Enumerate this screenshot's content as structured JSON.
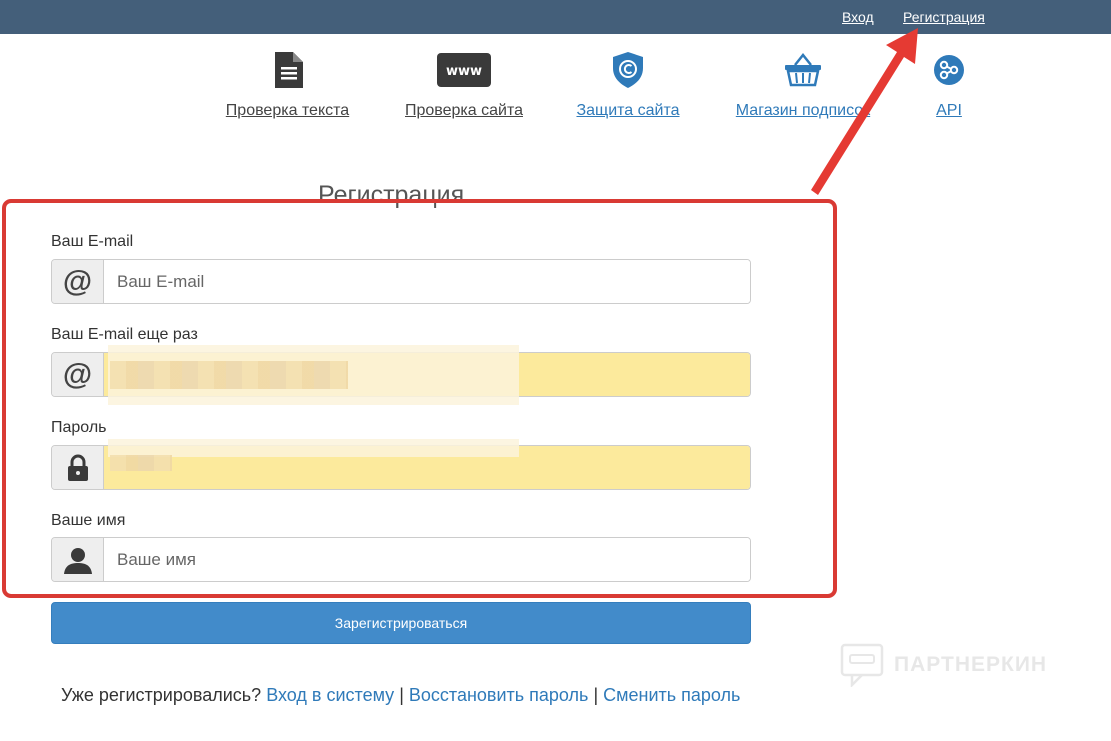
{
  "topbar": {
    "login": "Вход",
    "register": "Регистрация"
  },
  "services": [
    {
      "label": "Проверка текста",
      "icon": "document-icon"
    },
    {
      "label": "Проверка сайта",
      "icon": "www-icon"
    },
    {
      "label": "Защита сайта",
      "icon": "copyright-shield-icon"
    },
    {
      "label": "Магазин подписок",
      "icon": "basket-icon"
    },
    {
      "label": "API",
      "icon": "api-nodes-icon"
    }
  ],
  "form": {
    "title": "Регистрация",
    "email": {
      "label": "Ваш E-mail",
      "placeholder": "Ваш E-mail",
      "addon": "@"
    },
    "email_repeat": {
      "label": "Ваш E-mail еще раз",
      "addon": "@"
    },
    "password": {
      "label": "Пароль"
    },
    "name": {
      "label": "Ваше имя",
      "placeholder": "Ваше имя"
    },
    "submit": "Зарегистрироваться"
  },
  "footer": {
    "prompt": "Уже регистрировались?",
    "login_link": "Вход в систему",
    "separator": "|",
    "restore_link": "Восстановить пароль",
    "change_link": "Сменить пароль"
  },
  "watermark": "ПАРТНЕРКИН",
  "colors": {
    "topbar": "#445f7a",
    "accent": "#428bca",
    "highlight": "#d93a34",
    "autofill": "#fcea9c"
  }
}
